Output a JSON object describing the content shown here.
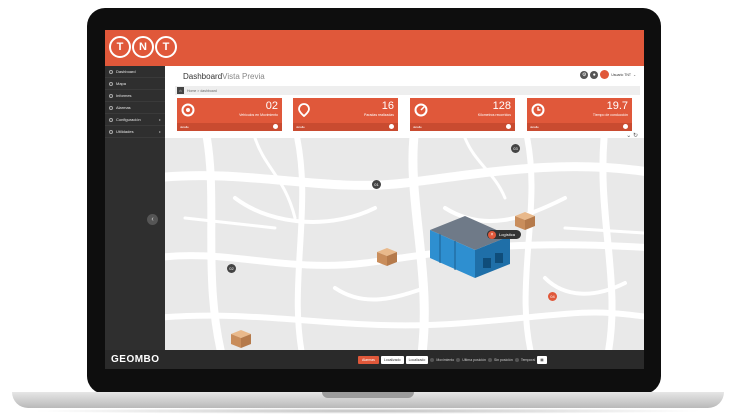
{
  "header": {
    "logo_letters": [
      "T",
      "N",
      "T"
    ]
  },
  "sidebar": {
    "items": [
      {
        "label": "Dashboard"
      },
      {
        "label": "Mapa"
      },
      {
        "label": "Informes"
      },
      {
        "label": "Alarmas"
      },
      {
        "label": "Configuración"
      },
      {
        "label": "Utilidades"
      }
    ],
    "collapse_icon": "chevron-left-icon"
  },
  "page": {
    "title": "Dashboard",
    "subtitle": "Vista Previa",
    "user_name": "Usuario TNT",
    "breadcrumb": "Home > dashboard"
  },
  "kpis": [
    {
      "value": "02",
      "label": "Vehículos en Movimiento",
      "footer": "detalle",
      "icon": "gear-icon"
    },
    {
      "value": "16",
      "label": "Paradas realizadas",
      "footer": "detalle",
      "icon": "location-pin-icon"
    },
    {
      "value": "128",
      "label": "Kilometros recorridos",
      "footer": "detalle",
      "icon": "speedometer-icon"
    },
    {
      "value": "19.7",
      "label": "Tiempo de conducción",
      "footer": "detalle",
      "icon": "clock-icon"
    }
  ],
  "map": {
    "markers": [
      "01",
      "02",
      "03",
      "04"
    ],
    "logistic_label": "Logística"
  },
  "footer": {
    "brand": "GEOMBO",
    "alert_button": "Alarmas",
    "select1": "Localizado",
    "select2": "Localizado",
    "option1": "Movimiento",
    "option2": "Ultima posición",
    "option3": "Sin posición",
    "option4": "Temporal"
  },
  "colors": {
    "brand": "#e0583a",
    "sidebar": "#2f2f2f"
  }
}
